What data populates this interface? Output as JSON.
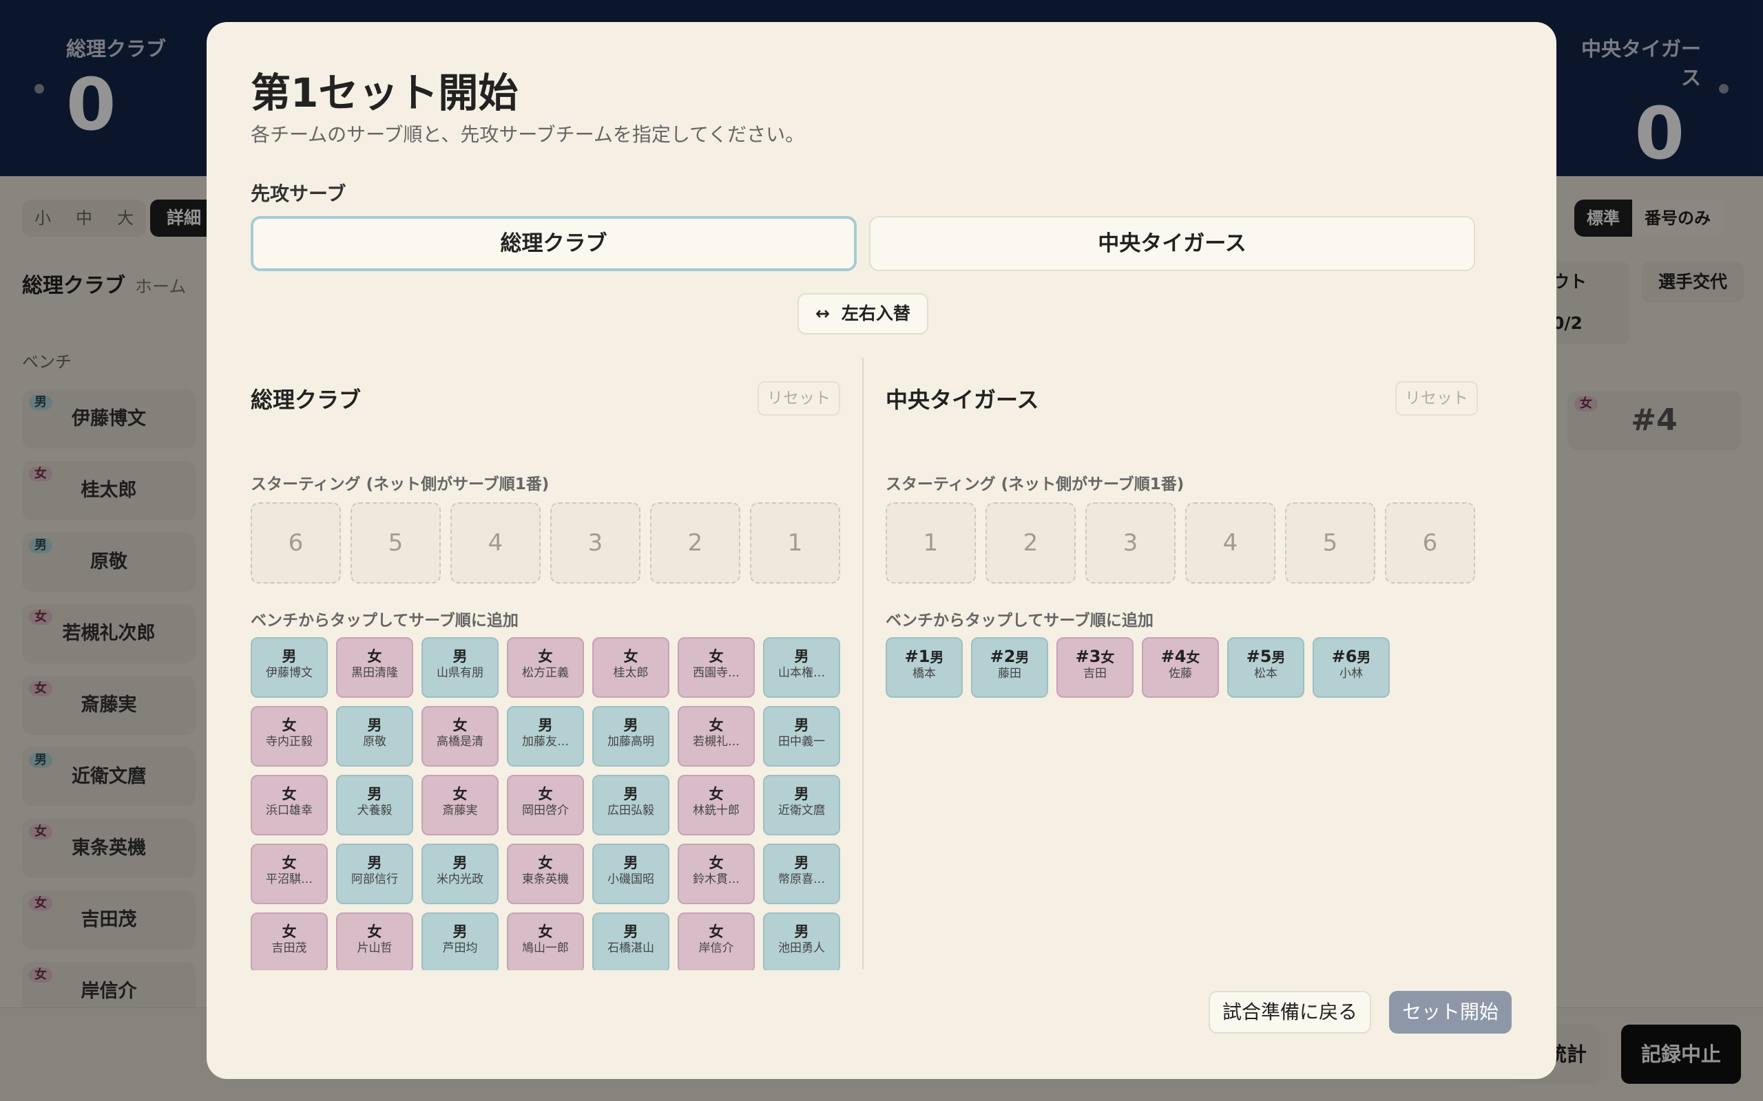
{
  "scoreboard": {
    "home": {
      "name": "総理クラブ",
      "score": "0"
    },
    "away": {
      "name": "中央タイガース",
      "score": "0"
    }
  },
  "toolbar": {
    "size_options": [
      "小",
      "中",
      "大"
    ],
    "detail_label": "詳細",
    "view_standard": "標準",
    "view_number_only": "番号のみ",
    "timeout_label": "ウト 0/2",
    "substitution_label": "選手交代"
  },
  "bg_panel": {
    "team": "総理クラブ",
    "side": "ホーム",
    "bench_label": "ベンチ",
    "bench": [
      {
        "g": "男",
        "name": "伊藤博文"
      },
      {
        "g": "女",
        "name": "桂太郎"
      },
      {
        "g": "男",
        "name": "原敬"
      },
      {
        "g": "女",
        "name": "若槻礼次郎"
      },
      {
        "g": "女",
        "name": "斎藤実"
      },
      {
        "g": "男",
        "name": "近衛文麿"
      },
      {
        "g": "女",
        "name": "東条英機"
      },
      {
        "g": "女",
        "name": "吉田茂"
      },
      {
        "g": "女",
        "name": "岸信介"
      }
    ],
    "right_card": {
      "g": "女",
      "num": "#4"
    },
    "stats_label": "統計",
    "stop_label": "記録中止"
  },
  "modal": {
    "title": "第1セット開始",
    "subtitle": "各チームのサーブ順と、先攻サーブチームを指定してください。",
    "first_serve_label": "先攻サーブ",
    "serve_options": [
      "総理クラブ",
      "中央タイガース"
    ],
    "selected_serve": "総理クラブ",
    "swap_icon": "↔",
    "swap_label": "左右入替",
    "reset_label": "リセット",
    "starting_label": "スターティング (ネット側がサーブ順1番)",
    "add_hint": "ベンチからタップしてサーブ順に追加",
    "left": {
      "team": "総理クラブ",
      "slots": [
        "6",
        "5",
        "4",
        "3",
        "2",
        "1"
      ],
      "players": [
        {
          "g": "男",
          "name": "伊藤博文"
        },
        {
          "g": "女",
          "name": "黒田清隆"
        },
        {
          "g": "男",
          "name": "山県有朋"
        },
        {
          "g": "女",
          "name": "松方正義"
        },
        {
          "g": "女",
          "name": "桂太郎"
        },
        {
          "g": "女",
          "name": "西園寺…"
        },
        {
          "g": "男",
          "name": "山本権…"
        },
        {
          "g": "女",
          "name": "寺内正毅"
        },
        {
          "g": "男",
          "name": "原敬"
        },
        {
          "g": "女",
          "name": "高橋是清"
        },
        {
          "g": "男",
          "name": "加藤友…"
        },
        {
          "g": "男",
          "name": "加藤高明"
        },
        {
          "g": "女",
          "name": "若槻礼…"
        },
        {
          "g": "男",
          "name": "田中義一"
        },
        {
          "g": "女",
          "name": "浜口雄幸"
        },
        {
          "g": "男",
          "name": "犬養毅"
        },
        {
          "g": "女",
          "name": "斎藤実"
        },
        {
          "g": "女",
          "name": "岡田啓介"
        },
        {
          "g": "男",
          "name": "広田弘毅"
        },
        {
          "g": "女",
          "name": "林銑十郎"
        },
        {
          "g": "男",
          "name": "近衛文麿"
        },
        {
          "g": "女",
          "name": "平沼騏…"
        },
        {
          "g": "男",
          "name": "阿部信行"
        },
        {
          "g": "男",
          "name": "米内光政"
        },
        {
          "g": "女",
          "name": "東条英機"
        },
        {
          "g": "男",
          "name": "小磯国昭"
        },
        {
          "g": "女",
          "name": "鈴木貫…"
        },
        {
          "g": "男",
          "name": "幣原喜…"
        },
        {
          "g": "女",
          "name": "吉田茂"
        },
        {
          "g": "女",
          "name": "片山哲"
        },
        {
          "g": "男",
          "name": "芦田均"
        },
        {
          "g": "女",
          "name": "鳩山一郎"
        },
        {
          "g": "男",
          "name": "石橋湛山"
        },
        {
          "g": "女",
          "name": "岸信介"
        },
        {
          "g": "男",
          "name": "池田勇人"
        }
      ]
    },
    "right": {
      "team": "中央タイガース",
      "slots": [
        "1",
        "2",
        "3",
        "4",
        "5",
        "6"
      ],
      "players": [
        {
          "num": "#1",
          "g": "男",
          "name": "橋本"
        },
        {
          "num": "#2",
          "g": "男",
          "name": "藤田"
        },
        {
          "num": "#3",
          "g": "女",
          "name": "吉田"
        },
        {
          "num": "#4",
          "g": "女",
          "name": "佐藤"
        },
        {
          "num": "#5",
          "g": "男",
          "name": "松本"
        },
        {
          "num": "#6",
          "g": "男",
          "name": "小林"
        }
      ]
    },
    "back_label": "試合準備に戻る",
    "start_label": "セット開始"
  }
}
